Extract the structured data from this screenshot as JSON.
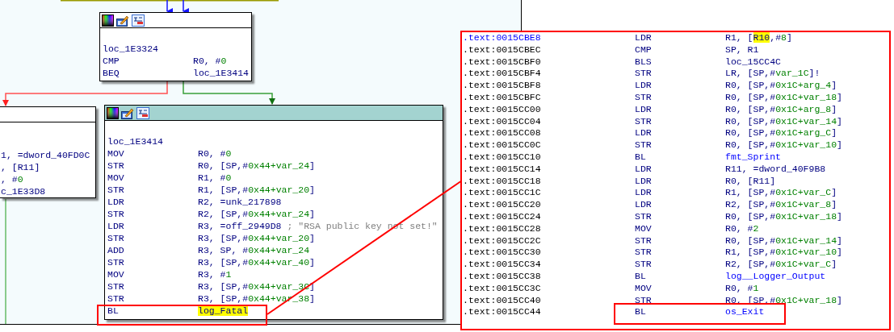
{
  "graph": {
    "blocks": [
      {
        "kind": "full",
        "selected": false,
        "label": "loc_1E3324",
        "lines": [
          {
            "mnemonic": "CMP",
            "operand": [
              {
                "text": "R0, #",
                "kind": "text"
              },
              {
                "text": "0",
                "kind": "num"
              }
            ]
          },
          {
            "mnemonic": "BEQ",
            "operand": [
              {
                "text": "loc_1E3414",
                "kind": "text"
              }
            ]
          }
        ]
      },
      {
        "kind": "partial",
        "selected": false,
        "lines": [
          {
            "operand": [
              {
                "text": "1, =dword_40FD0C",
                "kind": "text"
              }
            ]
          },
          {
            "operand": [
              {
                "text": ", [R11]",
                "kind": "text"
              }
            ]
          },
          {
            "operand": [
              {
                "text": ", #",
                "kind": "text"
              },
              {
                "text": "0",
                "kind": "num"
              }
            ]
          },
          {
            "operand": [
              {
                "text": "c_1E33D8",
                "kind": "text"
              }
            ]
          }
        ]
      },
      {
        "kind": "full",
        "selected": true,
        "label": "loc_1E3414",
        "lines": [
          {
            "mnemonic": "MOV",
            "operand": [
              {
                "text": "R0, #",
                "kind": "text"
              },
              {
                "text": "0",
                "kind": "num"
              }
            ]
          },
          {
            "mnemonic": "STR",
            "operand": [
              {
                "text": "R0, [SP,#",
                "kind": "text"
              },
              {
                "text": "0x44+var_24",
                "kind": "num"
              },
              {
                "text": "]",
                "kind": "text"
              }
            ]
          },
          {
            "mnemonic": "MOV",
            "operand": [
              {
                "text": "R1, #",
                "kind": "text"
              },
              {
                "text": "0",
                "kind": "num"
              }
            ]
          },
          {
            "mnemonic": "STR",
            "operand": [
              {
                "text": "R1, [SP,#",
                "kind": "text"
              },
              {
                "text": "0x44+var_20",
                "kind": "num"
              },
              {
                "text": "]",
                "kind": "text"
              }
            ]
          },
          {
            "mnemonic": "LDR",
            "operand": [
              {
                "text": "R2, =unk_217898",
                "kind": "text"
              }
            ]
          },
          {
            "mnemonic": "STR",
            "operand": [
              {
                "text": "R2, [SP,#",
                "kind": "text"
              },
              {
                "text": "0x44+var_24",
                "kind": "num"
              },
              {
                "text": "]",
                "kind": "text"
              }
            ]
          },
          {
            "mnemonic": "LDR",
            "operand": [
              {
                "text": "R3, =off_2949D8 ",
                "kind": "text"
              },
              {
                "text": "; \"RSA public key not set!\"",
                "kind": "comment"
              }
            ]
          },
          {
            "mnemonic": "STR",
            "operand": [
              {
                "text": "R3, [SP,#",
                "kind": "text"
              },
              {
                "text": "0x44+var_20",
                "kind": "num"
              },
              {
                "text": "]",
                "kind": "text"
              }
            ]
          },
          {
            "mnemonic": "ADD",
            "operand": [
              {
                "text": "R3, SP, #",
                "kind": "text"
              },
              {
                "text": "0x44+var_24",
                "kind": "num"
              }
            ]
          },
          {
            "mnemonic": "STR",
            "operand": [
              {
                "text": "R3, [SP,#",
                "kind": "text"
              },
              {
                "text": "0x44+var_40",
                "kind": "num"
              },
              {
                "text": "]",
                "kind": "text"
              }
            ]
          },
          {
            "mnemonic": "MOV",
            "operand": [
              {
                "text": "R3, #",
                "kind": "text"
              },
              {
                "text": "1",
                "kind": "num"
              }
            ]
          },
          {
            "mnemonic": "STR",
            "operand": [
              {
                "text": "R3, [SP,#",
                "kind": "text"
              },
              {
                "text": "0x44+var_3C",
                "kind": "num"
              },
              {
                "text": "]",
                "kind": "text"
              }
            ]
          },
          {
            "mnemonic": "STR",
            "operand": [
              {
                "text": "R3, [SP,#",
                "kind": "text"
              },
              {
                "text": "0x44+var_38",
                "kind": "num"
              },
              {
                "text": "]",
                "kind": "text"
              }
            ]
          },
          {
            "mnemonic": "BL",
            "operand": [
              {
                "text": "log_Fatal",
                "kind": "highlight"
              }
            ]
          }
        ]
      }
    ]
  },
  "listing": {
    "rows": [
      {
        "address": ".text:0015CBE8",
        "current": true,
        "mnemonic": "LDR",
        "operand": [
          {
            "text": "R1, [",
            "kind": "text"
          },
          {
            "text": "R10",
            "kind": "highlight"
          },
          {
            "text": ",#",
            "kind": "text"
          },
          {
            "text": "8",
            "kind": "num"
          },
          {
            "text": "]",
            "kind": "text"
          }
        ]
      },
      {
        "address": ".text:0015CBEC",
        "current": false,
        "mnemonic": "CMP",
        "operand": [
          {
            "text": "SP, R1",
            "kind": "text"
          }
        ]
      },
      {
        "address": ".text:0015CBF0",
        "current": false,
        "mnemonic": "BLS",
        "operand": [
          {
            "text": "loc_15CC4C",
            "kind": "text"
          }
        ]
      },
      {
        "address": ".text:0015CBF4",
        "current": false,
        "mnemonic": "STR",
        "operand": [
          {
            "text": "LR, [SP,#",
            "kind": "text"
          },
          {
            "text": "var_1C",
            "kind": "num"
          },
          {
            "text": "]!",
            "kind": "text"
          }
        ]
      },
      {
        "address": ".text:0015CBF8",
        "current": false,
        "mnemonic": "LDR",
        "operand": [
          {
            "text": "R0, [SP,#",
            "kind": "text"
          },
          {
            "text": "0x1C+arg_4",
            "kind": "num"
          },
          {
            "text": "]",
            "kind": "text"
          }
        ]
      },
      {
        "address": ".text:0015CBFC",
        "current": false,
        "mnemonic": "STR",
        "operand": [
          {
            "text": "R0, [SP,#",
            "kind": "text"
          },
          {
            "text": "0x1C+var_18",
            "kind": "num"
          },
          {
            "text": "]",
            "kind": "text"
          }
        ]
      },
      {
        "address": ".text:0015CC00",
        "current": false,
        "mnemonic": "LDR",
        "operand": [
          {
            "text": "R0, [SP,#",
            "kind": "text"
          },
          {
            "text": "0x1C+arg_8",
            "kind": "num"
          },
          {
            "text": "]",
            "kind": "text"
          }
        ]
      },
      {
        "address": ".text:0015CC04",
        "current": false,
        "mnemonic": "STR",
        "operand": [
          {
            "text": "R0, [SP,#",
            "kind": "text"
          },
          {
            "text": "0x1C+var_14",
            "kind": "num"
          },
          {
            "text": "]",
            "kind": "text"
          }
        ]
      },
      {
        "address": ".text:0015CC08",
        "current": false,
        "mnemonic": "LDR",
        "operand": [
          {
            "text": "R0, [SP,#",
            "kind": "text"
          },
          {
            "text": "0x1C+arg_C",
            "kind": "num"
          },
          {
            "text": "]",
            "kind": "text"
          }
        ]
      },
      {
        "address": ".text:0015CC0C",
        "current": false,
        "mnemonic": "STR",
        "operand": [
          {
            "text": "R0, [SP,#",
            "kind": "text"
          },
          {
            "text": "0x1C+var_10",
            "kind": "num"
          },
          {
            "text": "]",
            "kind": "text"
          }
        ]
      },
      {
        "address": ".text:0015CC10",
        "current": false,
        "mnemonic": "BL",
        "operand": [
          {
            "text": "fmt_Sprint",
            "kind": "name"
          }
        ]
      },
      {
        "address": ".text:0015CC14",
        "current": false,
        "mnemonic": "LDR",
        "operand": [
          {
            "text": "R11, =dword_40F9B8",
            "kind": "text"
          }
        ]
      },
      {
        "address": ".text:0015CC18",
        "current": false,
        "mnemonic": "LDR",
        "operand": [
          {
            "text": "R0, [R11]",
            "kind": "text"
          }
        ]
      },
      {
        "address": ".text:0015CC1C",
        "current": false,
        "mnemonic": "LDR",
        "operand": [
          {
            "text": "R1, [SP,#",
            "kind": "text"
          },
          {
            "text": "0x1C+var_C",
            "kind": "num"
          },
          {
            "text": "]",
            "kind": "text"
          }
        ]
      },
      {
        "address": ".text:0015CC20",
        "current": false,
        "mnemonic": "LDR",
        "operand": [
          {
            "text": "R2, [SP,#",
            "kind": "text"
          },
          {
            "text": "0x1C+var_8",
            "kind": "num"
          },
          {
            "text": "]",
            "kind": "text"
          }
        ]
      },
      {
        "address": ".text:0015CC24",
        "current": false,
        "mnemonic": "STR",
        "operand": [
          {
            "text": "R0, [SP,#",
            "kind": "text"
          },
          {
            "text": "0x1C+var_18",
            "kind": "num"
          },
          {
            "text": "]",
            "kind": "text"
          }
        ]
      },
      {
        "address": ".text:0015CC28",
        "current": false,
        "mnemonic": "MOV",
        "operand": [
          {
            "text": "R0, #",
            "kind": "text"
          },
          {
            "text": "2",
            "kind": "num"
          }
        ]
      },
      {
        "address": ".text:0015CC2C",
        "current": false,
        "mnemonic": "STR",
        "operand": [
          {
            "text": "R0, [SP,#",
            "kind": "text"
          },
          {
            "text": "0x1C+var_14",
            "kind": "num"
          },
          {
            "text": "]",
            "kind": "text"
          }
        ]
      },
      {
        "address": ".text:0015CC30",
        "current": false,
        "mnemonic": "STR",
        "operand": [
          {
            "text": "R1, [SP,#",
            "kind": "text"
          },
          {
            "text": "0x1C+var_10",
            "kind": "num"
          },
          {
            "text": "]",
            "kind": "text"
          }
        ]
      },
      {
        "address": ".text:0015CC34",
        "current": false,
        "mnemonic": "STR",
        "operand": [
          {
            "text": "R2, [SP,#",
            "kind": "text"
          },
          {
            "text": "0x1C+var_C",
            "kind": "num"
          },
          {
            "text": "]",
            "kind": "text"
          }
        ]
      },
      {
        "address": ".text:0015CC38",
        "current": false,
        "mnemonic": "BL",
        "operand": [
          {
            "text": "log__Logger_Output",
            "kind": "name"
          }
        ]
      },
      {
        "address": ".text:0015CC3C",
        "current": false,
        "mnemonic": "MOV",
        "operand": [
          {
            "text": "R0, #",
            "kind": "text"
          },
          {
            "text": "1",
            "kind": "num"
          }
        ]
      },
      {
        "address": ".text:0015CC40",
        "current": false,
        "mnemonic": "STR",
        "operand": [
          {
            "text": "R0, [SP,#",
            "kind": "text"
          },
          {
            "text": "0x1C+var_18",
            "kind": "num"
          },
          {
            "text": "]",
            "kind": "text"
          }
        ]
      },
      {
        "address": ".text:0015CC44",
        "current": false,
        "mnemonic": "BL",
        "operand": [
          {
            "text": "os_Exit",
            "kind": "name"
          }
        ]
      }
    ]
  }
}
